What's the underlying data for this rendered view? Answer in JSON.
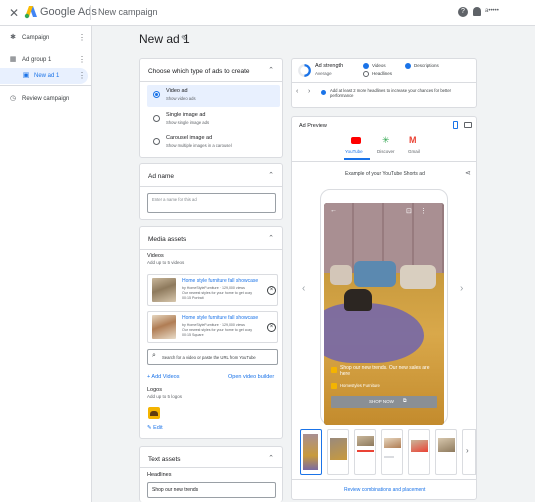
{
  "topbar": {
    "close_icon": "close-icon",
    "brand": "Google Ads",
    "title": "New campaign",
    "account": "a•••••"
  },
  "sidebar": {
    "items": [
      {
        "label": "Campaign",
        "icon": "campaign-icon"
      },
      {
        "label": "Ad group 1",
        "icon": "grid-icon"
      },
      {
        "label": "New ad 1",
        "icon": "ad-icon"
      },
      {
        "label": "Review campaign",
        "icon": "review-icon"
      }
    ]
  },
  "page": {
    "title": "New ad 1"
  },
  "ad_type": {
    "heading": "Choose which type of ads to create",
    "options": [
      {
        "title": "Video ad",
        "subtitle": "Show video ads",
        "selected": true
      },
      {
        "title": "Single image ad",
        "subtitle": "Show single image ads",
        "selected": false
      },
      {
        "title": "Carousel image ad",
        "subtitle": "Show multiple images in a carousel",
        "selected": false
      }
    ]
  },
  "ad_name": {
    "heading": "Ad name",
    "placeholder": "Enter a name for this ad"
  },
  "media": {
    "heading": "Media assets",
    "videos_label": "Videos",
    "videos_hint": "Add up to 5 videos",
    "videos": [
      {
        "title": "Home style furniture fall showcase",
        "meta1": "by HomeStyleFurniture · 129,000 views",
        "meta2": "Our newest styles for your home to get cozy",
        "meta3": "00:15 Portrait"
      },
      {
        "title": "Home style furniture fall showcase",
        "meta1": "by HomeStyleFurniture · 129,000 views",
        "meta2": "Our newest styles for your home to get cozy",
        "meta3": "00:15 Square"
      }
    ],
    "search_placeholder": "Search for a video or paste the URL from YouTube",
    "add_videos": "+ Add Videos",
    "open_builder": "Open video builder",
    "logos_label": "Logos",
    "logos_hint": "Add up to 5 logos",
    "edit": "Edit"
  },
  "text_assets": {
    "heading": "Text assets",
    "headlines_label": "Headlines",
    "headline_value": "Shop our new trends"
  },
  "ad_strength": {
    "label": "Ad strength",
    "value": "Average",
    "checks": [
      "Videos",
      "Descriptions",
      "Headlines"
    ],
    "tip": "Add at least 2 more headlines to increase your chances for better performance"
  },
  "preview": {
    "heading": "Ad Preview",
    "tabs": [
      "YouTube",
      "Discover",
      "Gmail"
    ],
    "caption": "Example of your YouTube Shorts ad",
    "ad_text": "Shop our new trends. Our new sales are here",
    "advertiser": "Homestyles Furniture",
    "cta": "SHOP NOW",
    "footer_link": "Review combinations and placement"
  },
  "colors": {
    "accent": "#1a73e8",
    "youtube": "#ff0000",
    "cta_bg": "#8a8f94",
    "sheet": "#7a6aa3"
  }
}
